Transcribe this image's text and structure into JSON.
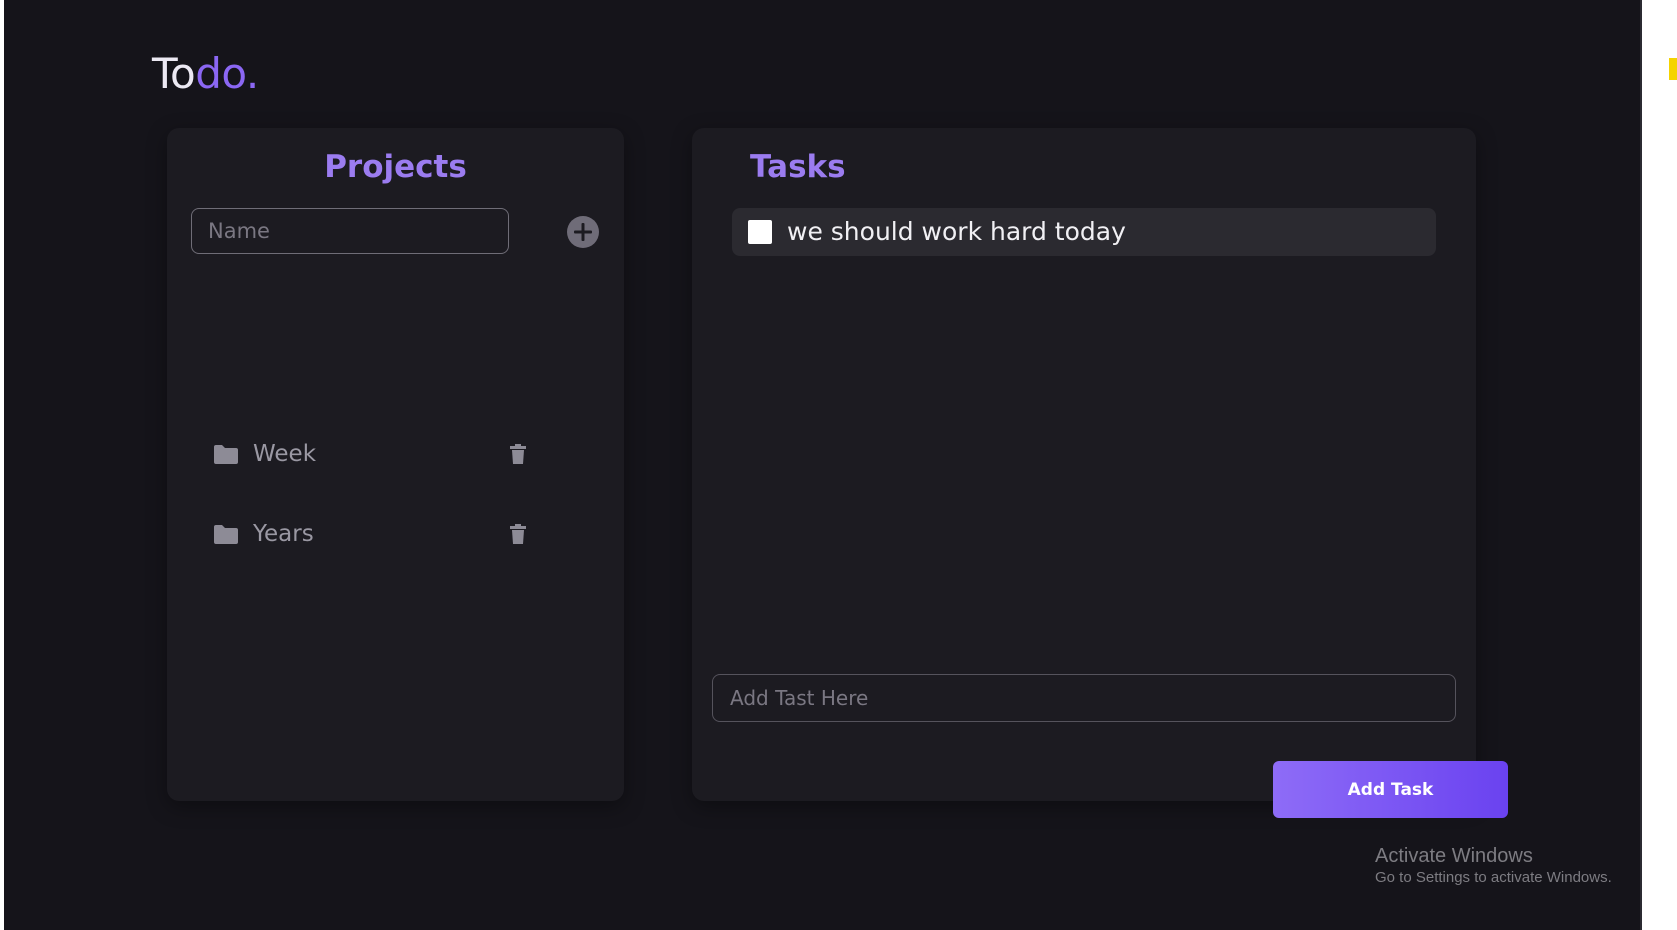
{
  "logo": {
    "part_light": "To",
    "part_accent": "do."
  },
  "projects": {
    "title": "Projects",
    "name_input": {
      "placeholder": "Name",
      "value": ""
    },
    "add_icon": "plus-circle-icon",
    "items": [
      {
        "label": "Week",
        "icon": "folder-icon",
        "action_icon": "trash-icon"
      },
      {
        "label": "Years",
        "icon": "folder-icon",
        "action_icon": "trash-icon"
      }
    ]
  },
  "tasks": {
    "title": "Tasks",
    "items": [
      {
        "text": "we should work hard today",
        "checked": false
      }
    ],
    "input": {
      "placeholder": "Add Tast Here",
      "value": ""
    },
    "add_button_label": "Add Task"
  },
  "watermark": {
    "title": "Activate Windows",
    "subtitle": "Go to Settings to activate Windows."
  },
  "colors": {
    "background": "#15141a",
    "panel": "#1c1b21",
    "accent": "#8b67f3",
    "title_accent": "#9b7cf0",
    "task_row": "#2b2a30",
    "button_gradient_start": "#8e6cf7",
    "button_gradient_end": "#6a42f0"
  }
}
